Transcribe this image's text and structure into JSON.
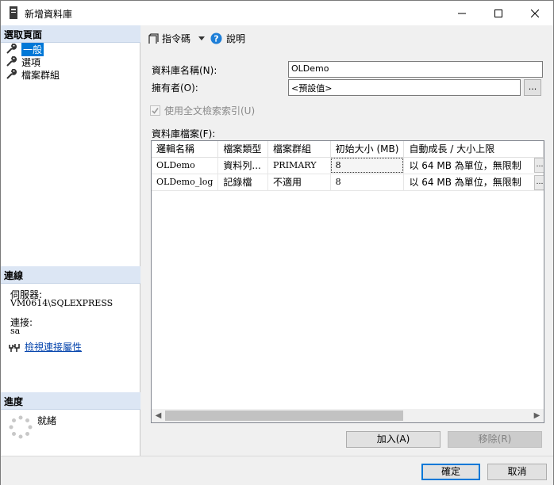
{
  "window": {
    "title": "新增資料庫"
  },
  "left_panel": {
    "select_page_header": "選取頁面",
    "pages": [
      {
        "label": "一般"
      },
      {
        "label": "選項"
      },
      {
        "label": "檔案群組"
      }
    ],
    "connection_header": "連線",
    "server_label": "伺服器:",
    "server_value": "VM0614\\SQLEXPRESS",
    "connection_label": "連接:",
    "connection_value": "sa",
    "view_connection_link": "檢視連接屬性",
    "progress_header": "進度",
    "progress_status": "就緒"
  },
  "toolbar": {
    "script_label": "指令碼",
    "help_label": "說明"
  },
  "form": {
    "db_name_label": "資料庫名稱(N):",
    "db_name_value": "OLDemo",
    "owner_label": "擁有者(O):",
    "owner_value": "<預設值>",
    "browse_label": "...",
    "fulltext_label": "使用全文檢索索引(U)",
    "fulltext_checked": true,
    "db_files_label": "資料庫檔案(F):"
  },
  "grid": {
    "columns": [
      "邏輯名稱",
      "檔案類型",
      "檔案群組",
      "初始大小 (MB)",
      "自動成長 / 大小上限"
    ],
    "rows": [
      [
        "OLDemo",
        "資料列...",
        "PRIMARY",
        "8",
        "以 64 MB 為單位，無限制"
      ],
      [
        "OLDemo_log",
        "記錄檔",
        "不適用",
        "8",
        "以 64 MB 為單位，無限制"
      ]
    ]
  },
  "buttons": {
    "add": "加入(A)",
    "remove": "移除(R)",
    "ok": "確定",
    "cancel": "取消"
  },
  "colors": {
    "accent": "#0078d7",
    "section_header": "#dce6f4",
    "help_icon": "#1e7fd8"
  }
}
